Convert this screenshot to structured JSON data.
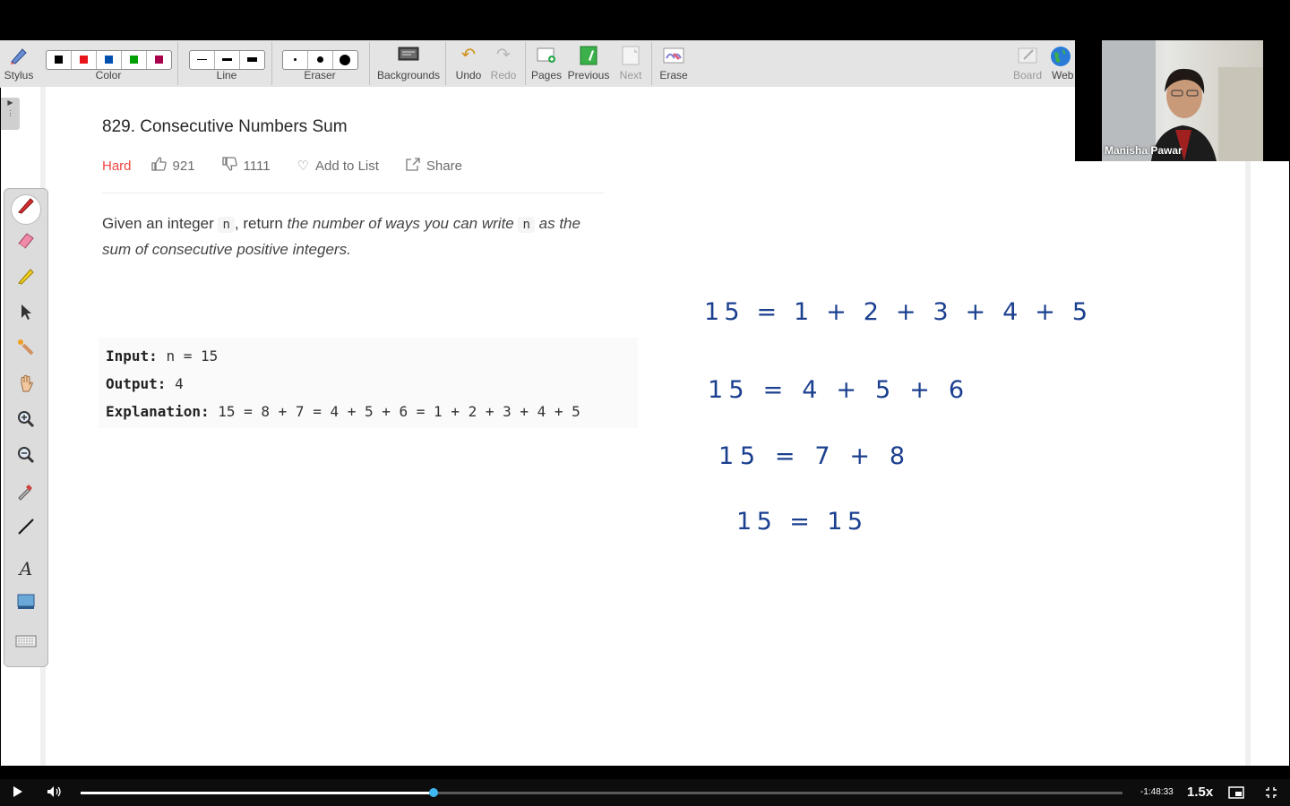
{
  "toolbar": {
    "stylus": "Stylus",
    "color": "Color",
    "line": "Line",
    "eraser": "Eraser",
    "backgrounds": "Backgrounds",
    "undo": "Undo",
    "redo": "Redo",
    "pages": "Pages",
    "previous": "Previous",
    "next": "Next",
    "erase": "Erase",
    "board": "Board",
    "web": "Web",
    "colors": [
      "#000000",
      "#e8141a",
      "#0050b0",
      "#00a000",
      "#a8004a"
    ]
  },
  "sidebar": {
    "tools": [
      "pen-icon",
      "eraser-icon",
      "highlighter-icon",
      "pointer-icon",
      "laser-pointer-icon",
      "hand-icon",
      "zoom-in-icon",
      "zoom-out-icon",
      "color-picker-icon",
      "line-tool-icon",
      "text-tool-icon",
      "screenshot-icon",
      "keyboard-icon"
    ],
    "text_tool": "A"
  },
  "problem": {
    "title": "829. Consecutive Numbers Sum",
    "difficulty": "Hard",
    "difficulty_color": "#ef4743",
    "likes": "921",
    "dislikes": "1111",
    "add_to_list": "Add to List",
    "share": "Share",
    "desc_1": "Given an integer",
    "var_n": "n",
    "desc_2": ", return",
    "desc_em_1": "the number of ways you can write",
    "desc_em_2": "as the sum of consecutive positive integers.",
    "example": {
      "input_label": "Input:",
      "input_value": "n = 15",
      "output_label": "Output:",
      "output_value": "4",
      "explanation_label": "Explanation:",
      "explanation_value": "15 = 8 + 7 = 4 + 5 + 6 = 1 + 2 + 3 + 4 + 5"
    }
  },
  "handwriting": {
    "line1": "15 = 1 + 2 + 3 + 4 + 5",
    "line2": "15 = 4 + 5 + 6",
    "line3": "15 = 7 + 8",
    "line4": "15 = 15",
    "ink_color": "#1b3f8f"
  },
  "webcam": {
    "name": "Manisha Pawar"
  },
  "player": {
    "time_remaining": "-1:48:33",
    "speed": "1.5x",
    "progress": 0.339
  }
}
